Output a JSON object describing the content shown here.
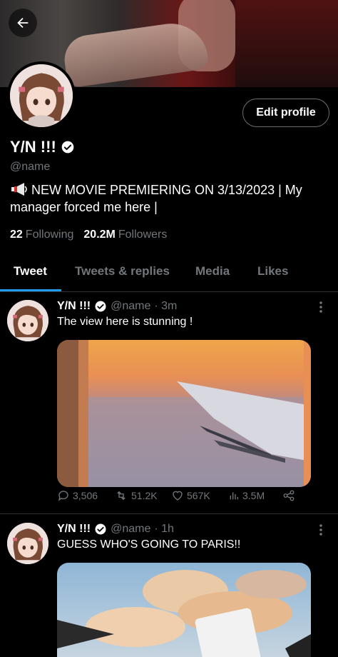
{
  "profile": {
    "display_name": "Y/N !!!",
    "handle": "@name",
    "bio": "NEW MOVIE PREMIERING ON 3/13/2023 | My manager forced me here |",
    "following_count": "22",
    "following_label": "Following",
    "followers_count": "20.2M",
    "followers_label": "Followers",
    "edit_label": "Edit profile"
  },
  "tabs": [
    {
      "label": "Tweet"
    },
    {
      "label": "Tweets & replies"
    },
    {
      "label": "Media"
    },
    {
      "label": "Likes"
    }
  ],
  "tweets": [
    {
      "name": "Y/N !!!",
      "handle": "@name",
      "time": "· 3m",
      "text": "The view here is stunning !",
      "replies": "3,506",
      "retweets": "51.2K",
      "likes": "567K",
      "views": "3.5M"
    },
    {
      "name": "Y/N !!!",
      "handle": "@name",
      "time": "· 1h",
      "text": "GUESS WHO'S GOING TO PARIS!!"
    }
  ],
  "colors": {
    "accent": "#1d9bf0",
    "muted": "#72777b",
    "background": "#000000"
  },
  "icons": [
    "back-arrow-icon",
    "verified-badge-icon",
    "megaphone-icon",
    "more-vertical-icon",
    "reply-icon",
    "retweet-icon",
    "like-icon",
    "views-icon",
    "share-icon"
  ]
}
